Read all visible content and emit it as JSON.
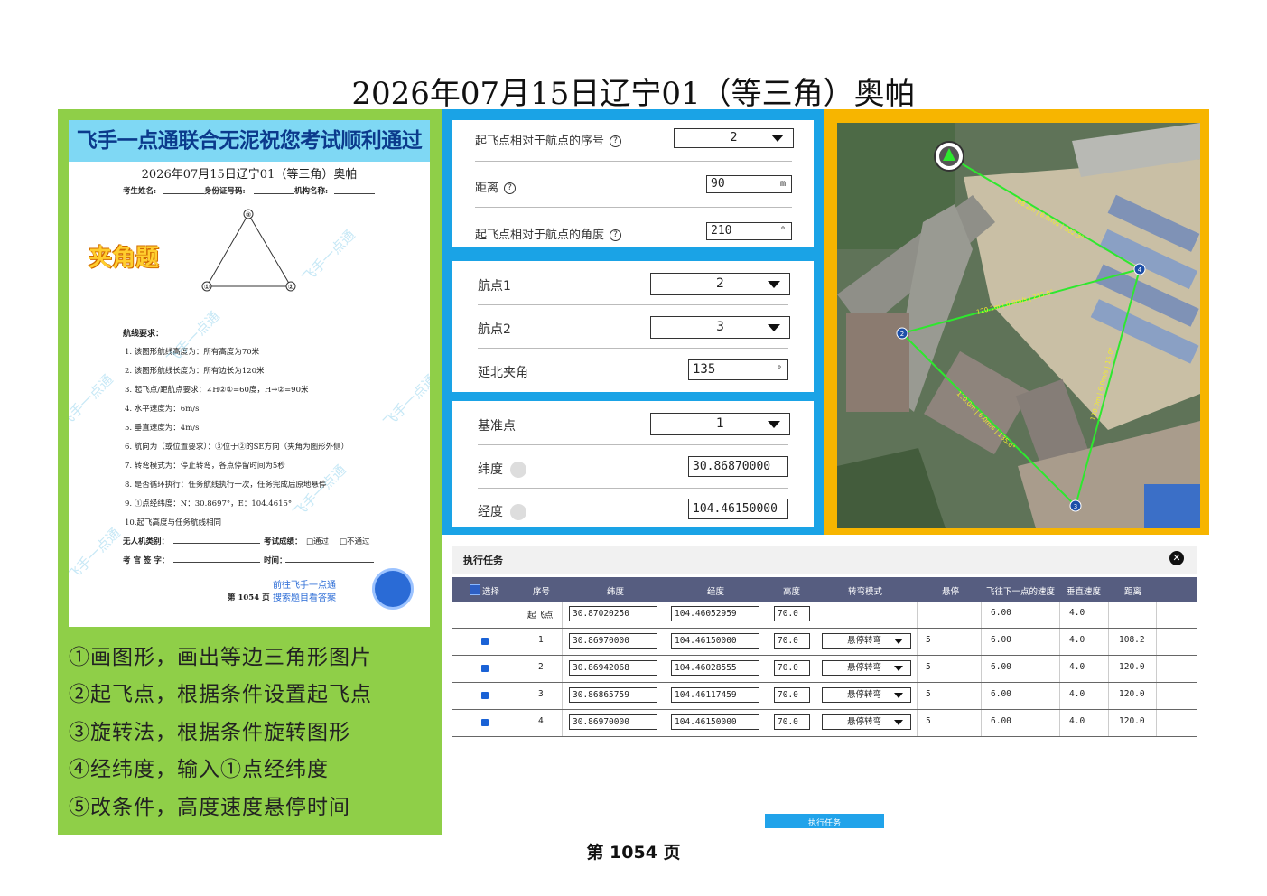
{
  "page_title": "2026年07月15日辽宁01（等三角）奥帕",
  "exam_paper": {
    "banner": "飞手一点通联合无泥祝您考试顺利通过",
    "title": "2026年07月15日辽宁01（等三角）奥帕",
    "fields": [
      "考生姓名:",
      "身份证号码:",
      "机构名称:"
    ],
    "angle_badge": "夹角题",
    "triangle_labels": [
      "③",
      "①",
      "②"
    ],
    "requirements_heading": "航线要求：",
    "requirements": [
      "1.  该图形航线高度为：所有高度为70米",
      "2.  该图形航线长度为：所有边长为120米",
      "3.  起飞点/距航点要求：∠H②①=60度，H→②=90米",
      "4.  水平速度为：6m/s",
      "5.  垂直速度为：4m/s",
      "6.  航向为（或位置要求）：③位于②的SE方向（夹角为图形外侧）",
      "7.  转弯模式为：停止转弯，各点停留时间为5秒",
      "8.  是否循环执行：任务航线执行一次，任务完成后原地悬停",
      "9.  ①点经纬度：N：30.8697°，E：104.4615°",
      "10.起飞高度与任务航线相同"
    ],
    "uav_type_label": "无人机类别：",
    "result_label": "考试成绩：",
    "pass_label": "□通过",
    "fail_label": "□不通过",
    "examiner_label": "考 官 签 字：",
    "time_label": "时间：",
    "page_label": "第 1054 页",
    "promo_line1": "前往飞手一点通",
    "promo_line2": "搜索题目看答案",
    "watermark": "飞手一点通"
  },
  "steps": [
    "①画图形，画出等边三角形图片",
    "②起飞点，根据条件设置起飞点",
    "③旋转法，根据条件旋转图形",
    "④经纬度，输入①点经纬度",
    "⑤改条件，高度速度悬停时间"
  ],
  "takeoff_panel": {
    "seq_label": "起飞点相对于航点的序号",
    "seq_value": "2",
    "distance_label": "距离",
    "distance_value": "90",
    "distance_unit": "m",
    "angle_label": "起飞点相对于航点的角度",
    "angle_value": "210",
    "angle_unit": "°",
    "help_icon": "?"
  },
  "rotation_panel": {
    "wp1_label": "航点1",
    "wp1_value": "2",
    "wp2_label": "航点2",
    "wp2_value": "3",
    "north_angle_label": "延北夹角",
    "north_angle_value": "135",
    "unit": "°"
  },
  "base_panel": {
    "base_label": "基准点",
    "base_value": "1",
    "lat_label": "纬度",
    "lat_value": "30.86870000",
    "lon_label": "经度",
    "lon_value": "104.46150000"
  },
  "map": {
    "edge_labels": [
      "108.2m | 6.0m/s | 302.3°",
      "120.1m | 6.0m/s | 255.0°",
      "120.0m | 6.0m/s | 135.0°",
      "120.0m | 6.0m/s | 15.0°"
    ],
    "waypoint_labels": [
      "2",
      "3",
      "4"
    ],
    "colors": {
      "route": "#2ee82e",
      "label": "#f3ef2a",
      "waypoint": "#1c4fa8"
    }
  },
  "task_table": {
    "title": "执行任务",
    "close_icon": "✕",
    "headers": [
      "选择",
      "序号",
      "纬度",
      "经度",
      "高度",
      "转弯模式",
      "悬停",
      "飞往下一点的速度",
      "垂直速度",
      "距离"
    ],
    "takeoff_row": {
      "seq": "起飞点",
      "lat": "30.87020250",
      "lon": "104.46052959",
      "alt": "70.0",
      "speed": "6.00",
      "vspeed": "4.0"
    },
    "rows": [
      {
        "seq": "1",
        "lat": "30.86970000",
        "lon": "104.46150000",
        "alt": "70.0",
        "turn": "悬停转弯",
        "hover": "5",
        "speed": "6.00",
        "vspeed": "4.0",
        "dist": "108.2"
      },
      {
        "seq": "2",
        "lat": "30.86942068",
        "lon": "104.46028555",
        "alt": "70.0",
        "turn": "悬停转弯",
        "hover": "5",
        "speed": "6.00",
        "vspeed": "4.0",
        "dist": "120.0"
      },
      {
        "seq": "3",
        "lat": "30.86865759",
        "lon": "104.46117459",
        "alt": "70.0",
        "turn": "悬停转弯",
        "hover": "5",
        "speed": "6.00",
        "vspeed": "4.0",
        "dist": "120.0"
      },
      {
        "seq": "4",
        "lat": "30.86970000",
        "lon": "104.46150000",
        "alt": "70.0",
        "turn": "悬停转弯",
        "hover": "5",
        "speed": "6.00",
        "vspeed": "4.0",
        "dist": "120.0"
      }
    ],
    "execute_button": "执行任务"
  },
  "page_number": "第 1054 页"
}
